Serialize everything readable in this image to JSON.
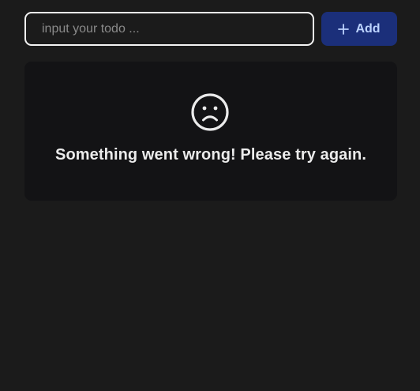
{
  "todo": {
    "input_value": "",
    "input_placeholder": "input your todo ...",
    "add_label": "Add"
  },
  "error": {
    "icon": "sad-face-icon",
    "message": "Something went wrong! Please try again."
  },
  "colors": {
    "background": "#1b1b1b",
    "card": "#131315",
    "button": "#1b2f7a",
    "button_text": "#bcd3ff",
    "text": "#ebebeb"
  }
}
